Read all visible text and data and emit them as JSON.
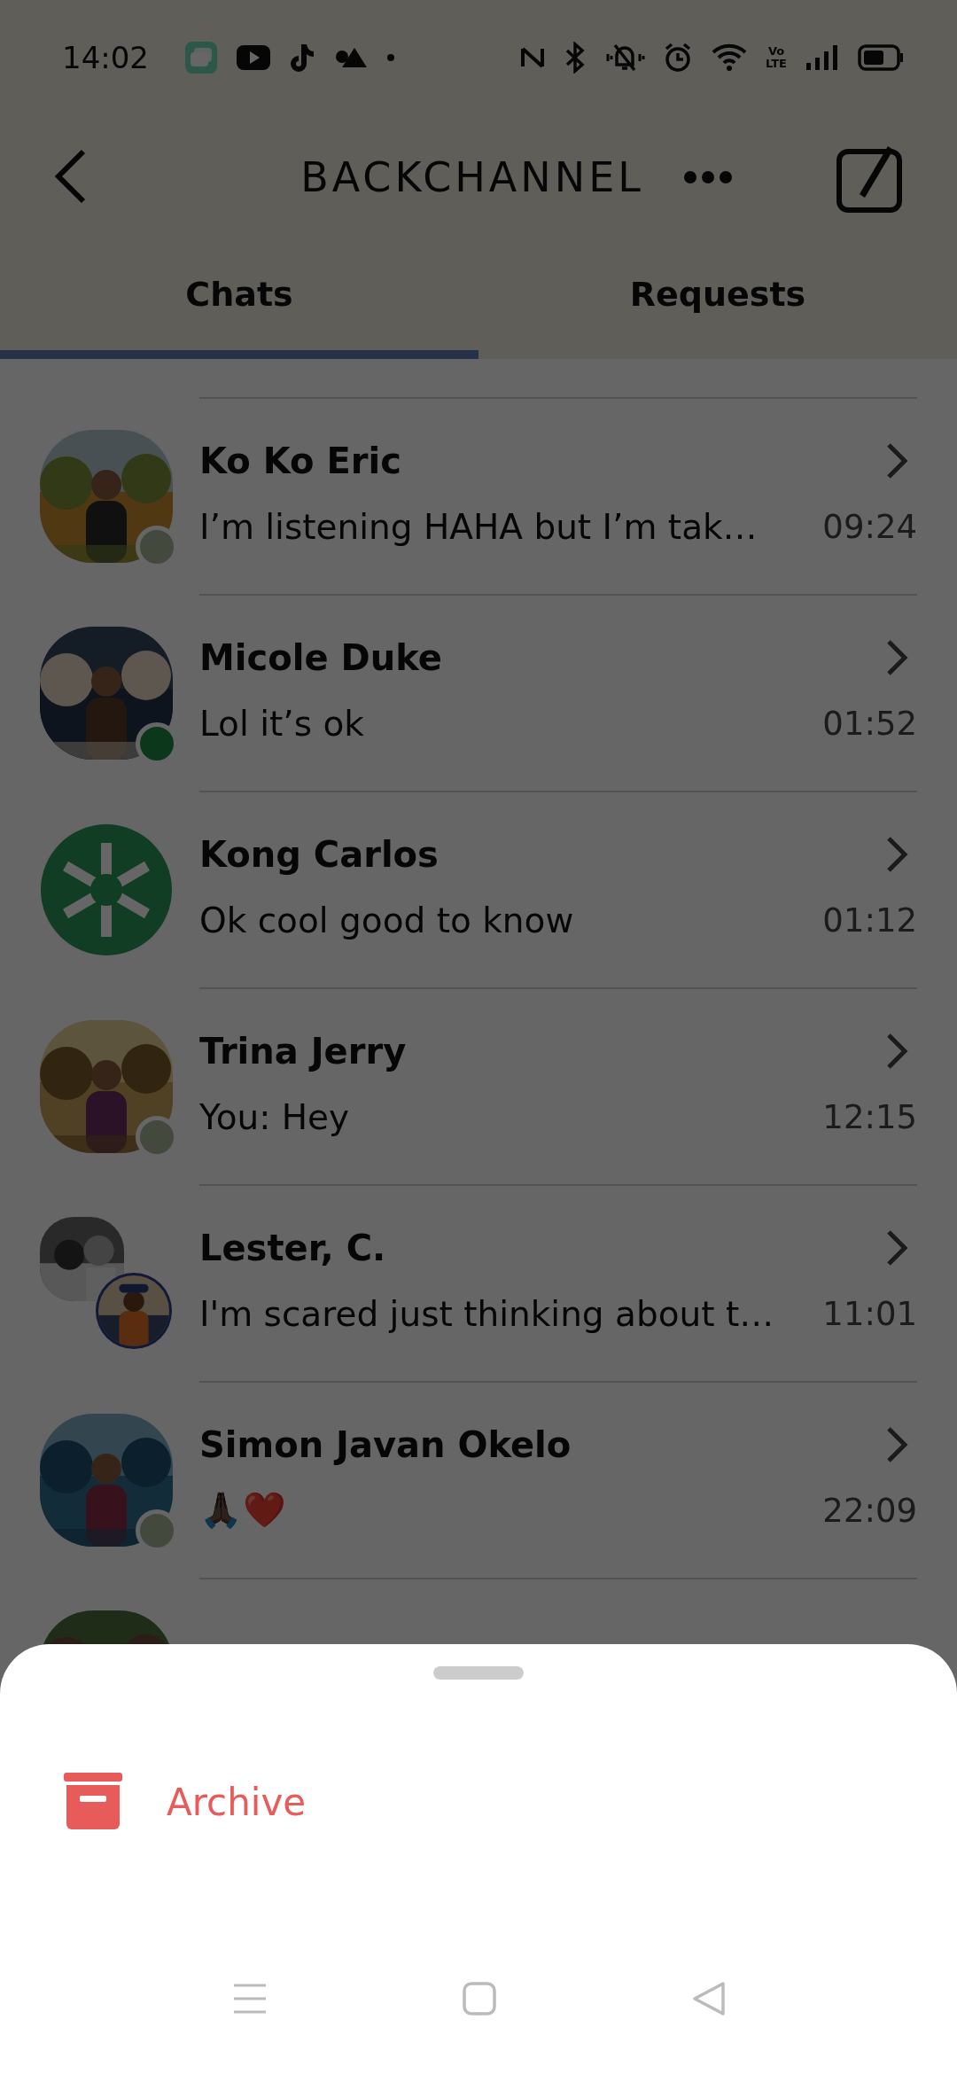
{
  "status_bar": {
    "time": "14:02",
    "network_label_top": "Vo",
    "network_label_bottom": "LTE"
  },
  "header": {
    "title": "BACKCHANNEL"
  },
  "tabs": [
    {
      "label": "Chats",
      "selected": true
    },
    {
      "label": "Requests",
      "selected": false
    }
  ],
  "chats": [
    {
      "name": "Ko Ko Eric",
      "preview": "I’m listening HAHA but I’m tak…",
      "time": "09:24",
      "status_dot": true,
      "online": false
    },
    {
      "name": "Micole Duke",
      "preview": "Lol it’s ok",
      "time": "01:52",
      "status_dot": true,
      "online": true
    },
    {
      "name": "Kong Carlos",
      "preview": "Ok cool good to know",
      "time": "01:12",
      "avatar": {
        "kind": "logo"
      },
      "status_dot": false
    },
    {
      "name": "Trina Jerry",
      "preview": "You: Hey",
      "time": "12:15",
      "status_dot": true,
      "online": false
    },
    {
      "name": "Lester, C.",
      "preview": "I'm scared just thinking about t…",
      "time": "11:01",
      "avatar": {
        "kind": "group"
      },
      "status_dot": false
    },
    {
      "name": "Simon Javan Okelo",
      "preview": "🙏🏿❤️",
      "time": "22:09",
      "status_dot": true,
      "online": false
    },
    {
      "status_dot": false
    }
  ],
  "sheet": {
    "actions": [
      {
        "label": "Archive",
        "kind": "archive"
      }
    ]
  }
}
